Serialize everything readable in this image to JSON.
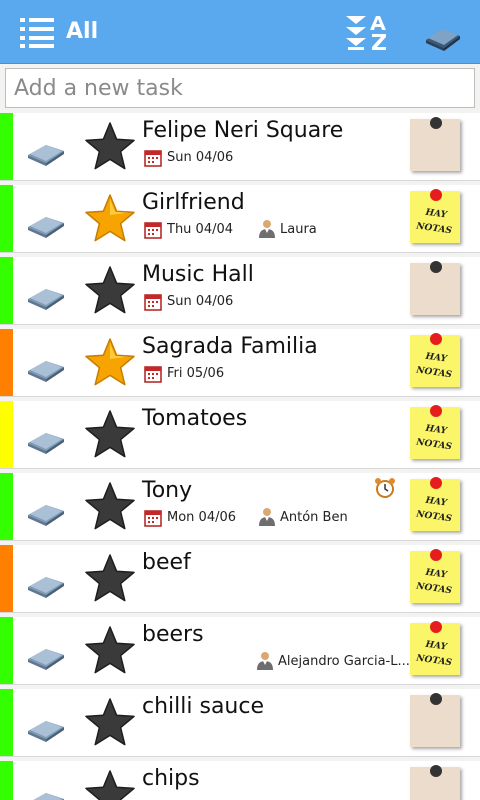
{
  "header": {
    "filter_label": "All",
    "icons": [
      "list-icon",
      "sort-az-icon",
      "sync-tray-icon"
    ]
  },
  "add_task": {
    "placeholder": "Add a new task",
    "value": ""
  },
  "colors": {
    "appbar": "#5aa8ee",
    "priority_green": "#33ff00",
    "priority_orange": "#ff8000",
    "priority_yellow": "#ffff00",
    "star_dark": "#3a3a3a",
    "star_gold": "#f7a400",
    "note_yellow": "#fbf56a",
    "note_plain": "#ecdccb"
  },
  "tasks": [
    {
      "title": "Felipe Neri Square",
      "date": "Sun 04/06",
      "person": "",
      "priority": "green",
      "starred": false,
      "alarm": false,
      "note_text": ""
    },
    {
      "title": "Girlfriend",
      "date": "Thu 04/04",
      "person": "Laura",
      "priority": "green",
      "starred": true,
      "alarm": false,
      "note_text": "HAY NOTAS"
    },
    {
      "title": "Music Hall",
      "date": "Sun 04/06",
      "person": "",
      "priority": "green",
      "starred": false,
      "alarm": false,
      "note_text": ""
    },
    {
      "title": "Sagrada Familia",
      "date": "Fri 05/06",
      "person": "",
      "priority": "orange",
      "starred": true,
      "alarm": false,
      "note_text": "HAY NOTAS"
    },
    {
      "title": "Tomatoes",
      "date": "",
      "person": "",
      "priority": "yellow",
      "starred": false,
      "alarm": false,
      "note_text": "HAY NOTAS"
    },
    {
      "title": "Tony",
      "date": "Mon 04/06",
      "person": "Antón Ben",
      "priority": "green",
      "starred": false,
      "alarm": true,
      "note_text": "HAY NOTAS"
    },
    {
      "title": "beef",
      "date": "",
      "person": "",
      "priority": "orange",
      "starred": false,
      "alarm": false,
      "note_text": "HAY NOTAS"
    },
    {
      "title": "beers",
      "date": "",
      "person": "Alejandro Garcia-L...",
      "priority": "green",
      "starred": false,
      "alarm": false,
      "note_text": "HAY NOTAS"
    },
    {
      "title": "chilli sauce",
      "date": "",
      "person": "",
      "priority": "green",
      "starred": false,
      "alarm": false,
      "note_text": ""
    },
    {
      "title": "chips",
      "date": "",
      "person": "",
      "priority": "green",
      "starred": false,
      "alarm": false,
      "note_text": ""
    }
  ]
}
